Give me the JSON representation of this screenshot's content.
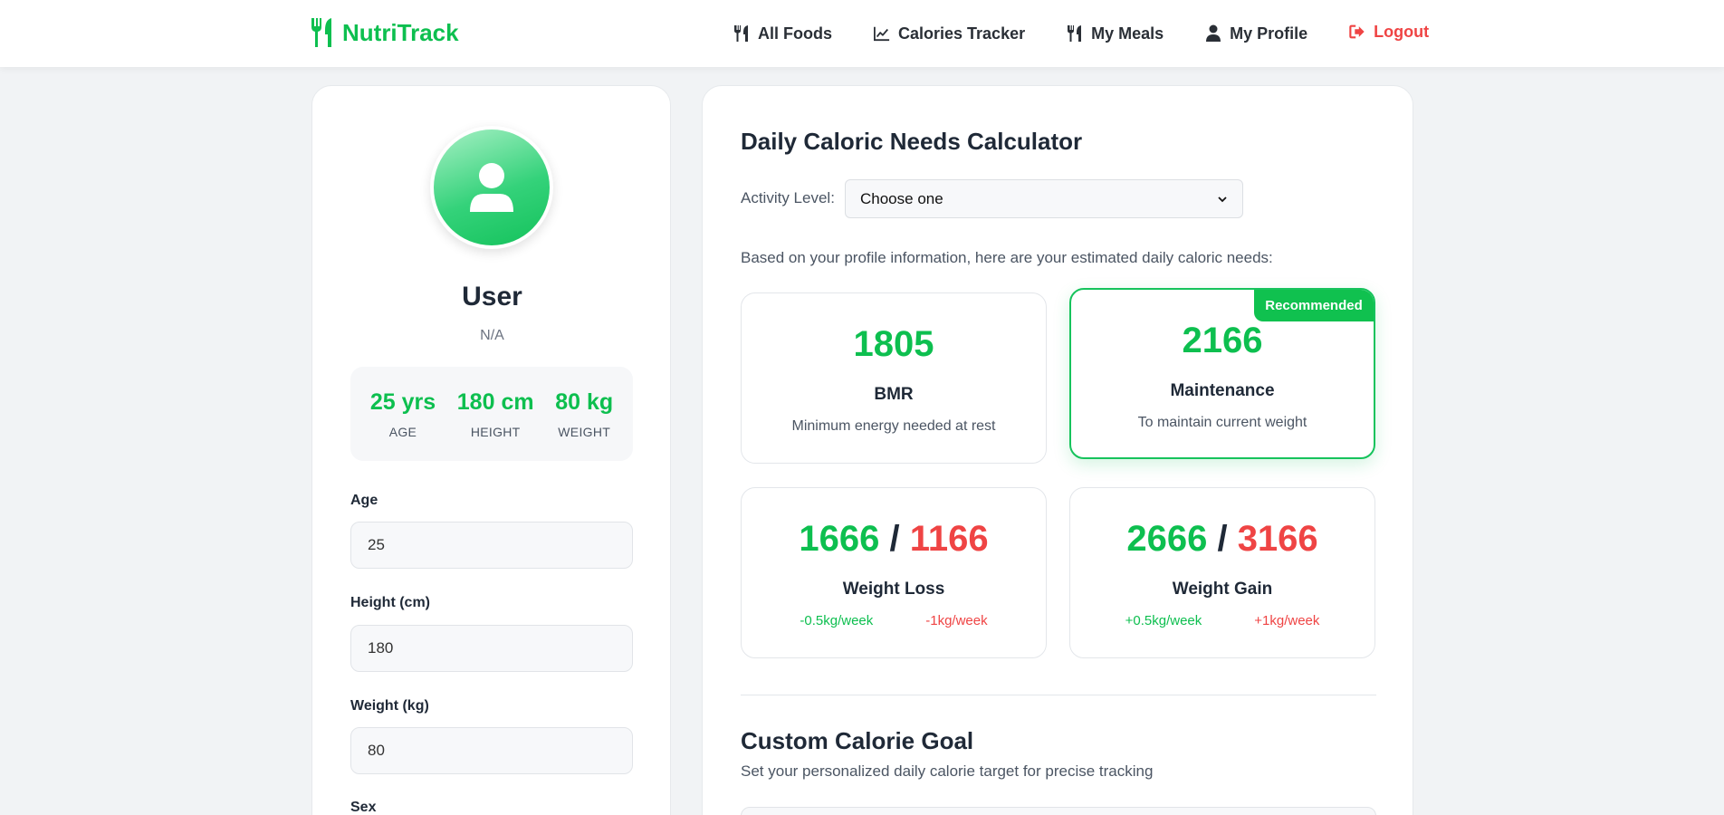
{
  "app": {
    "brand": "NutriTrack"
  },
  "nav": {
    "items": [
      {
        "label": "All Foods",
        "icon": "utensils-icon"
      },
      {
        "label": "Calories Tracker",
        "icon": "chart-line-icon"
      },
      {
        "label": "My Meals",
        "icon": "utensils-icon"
      },
      {
        "label": "My Profile",
        "icon": "user-icon"
      }
    ],
    "logout": "Logout"
  },
  "profile": {
    "name": "User",
    "subtitle": "N/A",
    "stats": [
      {
        "value": "25 yrs",
        "label": "AGE"
      },
      {
        "value": "180 cm",
        "label": "HEIGHT"
      },
      {
        "value": "80 kg",
        "label": "WEIGHT"
      }
    ],
    "fields": {
      "age": {
        "label": "Age",
        "value": "25"
      },
      "height": {
        "label": "Height (cm)",
        "value": "180"
      },
      "weight": {
        "label": "Weight (kg)",
        "value": "80"
      },
      "sex": {
        "label": "Sex"
      }
    }
  },
  "calculator": {
    "title": "Daily Caloric Needs Calculator",
    "activity_label": "Activity Level:",
    "activity_value": "Choose one",
    "intro": "Based on your profile information, here are your estimated daily caloric needs:",
    "bmr": {
      "value": "1805",
      "name": "BMR",
      "desc": "Minimum energy needed at rest"
    },
    "maintenance": {
      "value": "2166",
      "name": "Maintenance",
      "desc": "To maintain current weight",
      "badge": "Recommended"
    },
    "weight_loss": {
      "value_a": "1666",
      "slash": "/",
      "value_b": "1166",
      "name": "Weight Loss",
      "rate_a": "-0.5kg/week",
      "rate_b": "-1kg/week"
    },
    "weight_gain": {
      "value_a": "2666",
      "slash": "/",
      "value_b": "3166",
      "name": "Weight Gain",
      "rate_a": "+0.5kg/week",
      "rate_b": "+1kg/week"
    }
  },
  "custom_goal": {
    "title": "Custom Calorie Goal",
    "subtitle": "Set your personalized daily calorie target for precise tracking"
  },
  "colors": {
    "brand_green": "#0dbf4f",
    "danger_red": "#ef4444",
    "text_dark": "#1f2937",
    "background": "#f1f3f5"
  }
}
